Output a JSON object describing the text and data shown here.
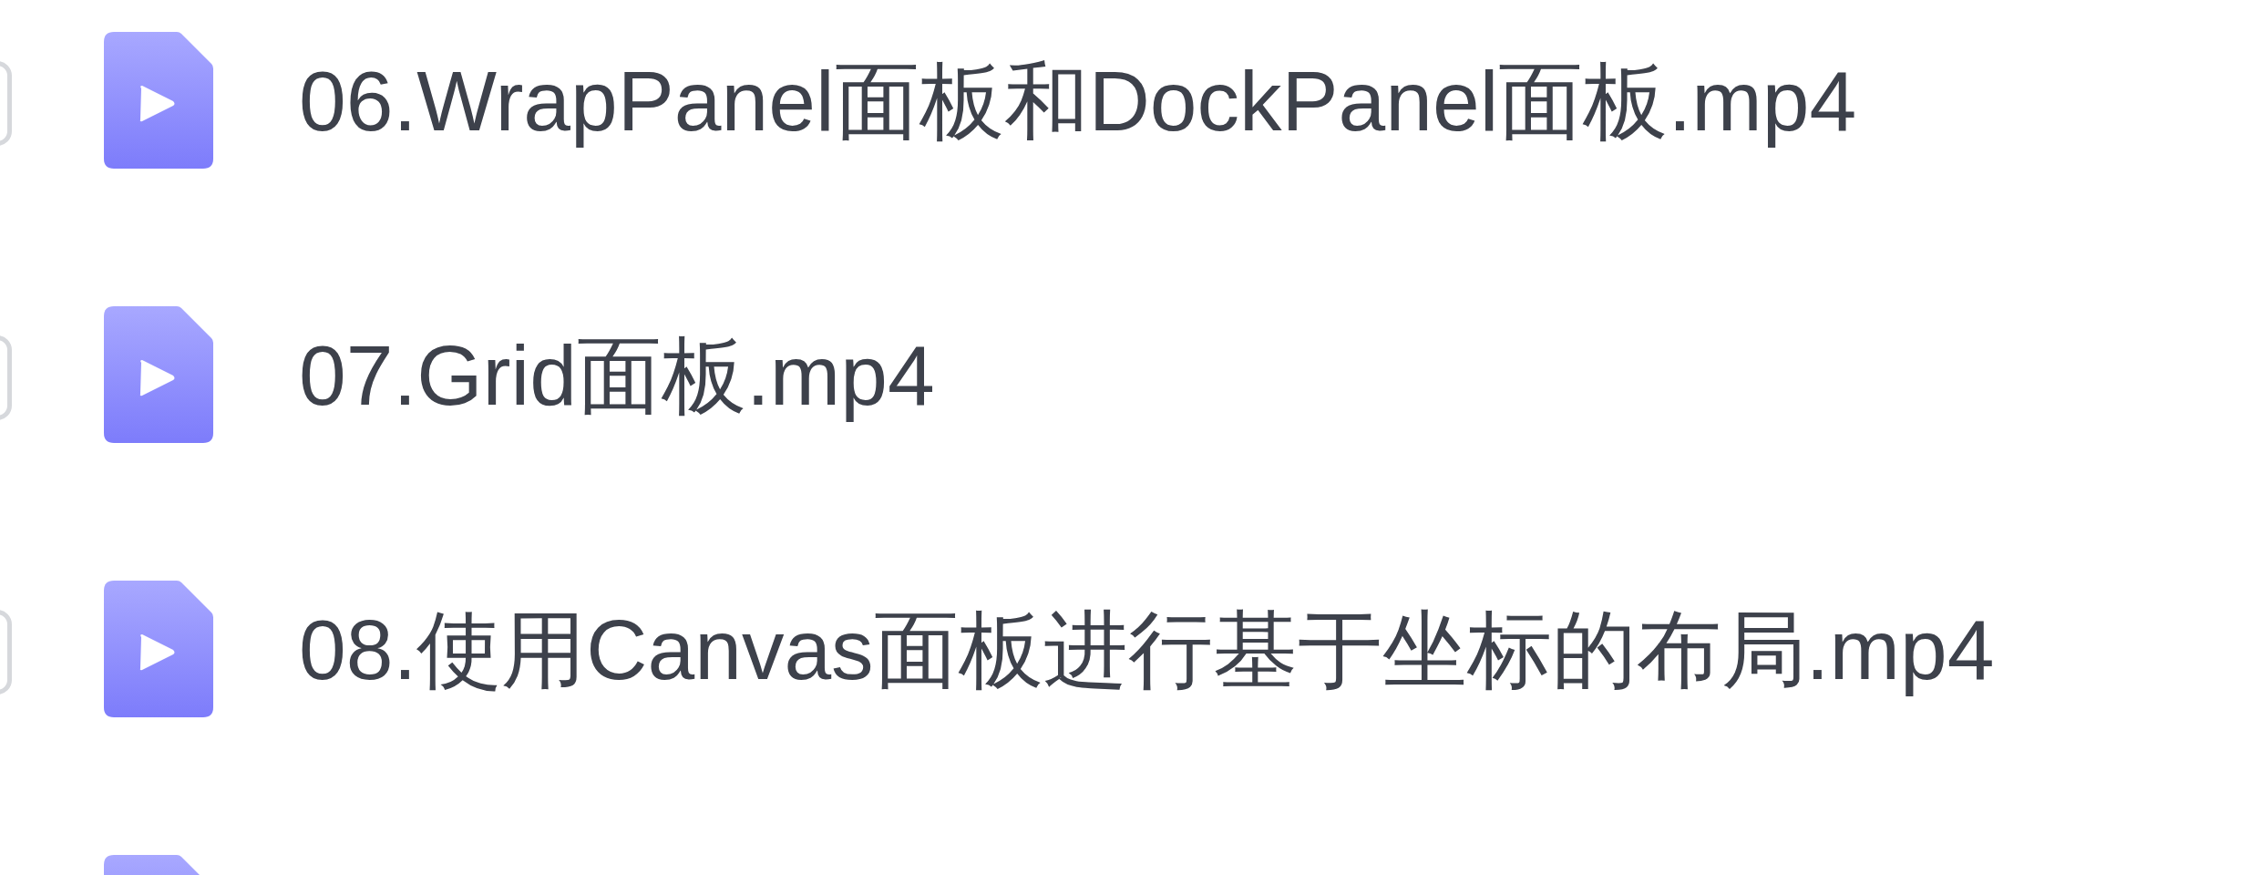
{
  "files": [
    {
      "kind": "video",
      "checked": false,
      "name": "06.WrapPanel面板和DockPanel面板.mp4"
    },
    {
      "kind": "video",
      "checked": false,
      "name": "07.Grid面板.mp4"
    },
    {
      "kind": "video",
      "checked": false,
      "name": "08.使用Canvas面板进行基于坐标的布局.mp4"
    },
    {
      "kind": "video"
    }
  ]
}
